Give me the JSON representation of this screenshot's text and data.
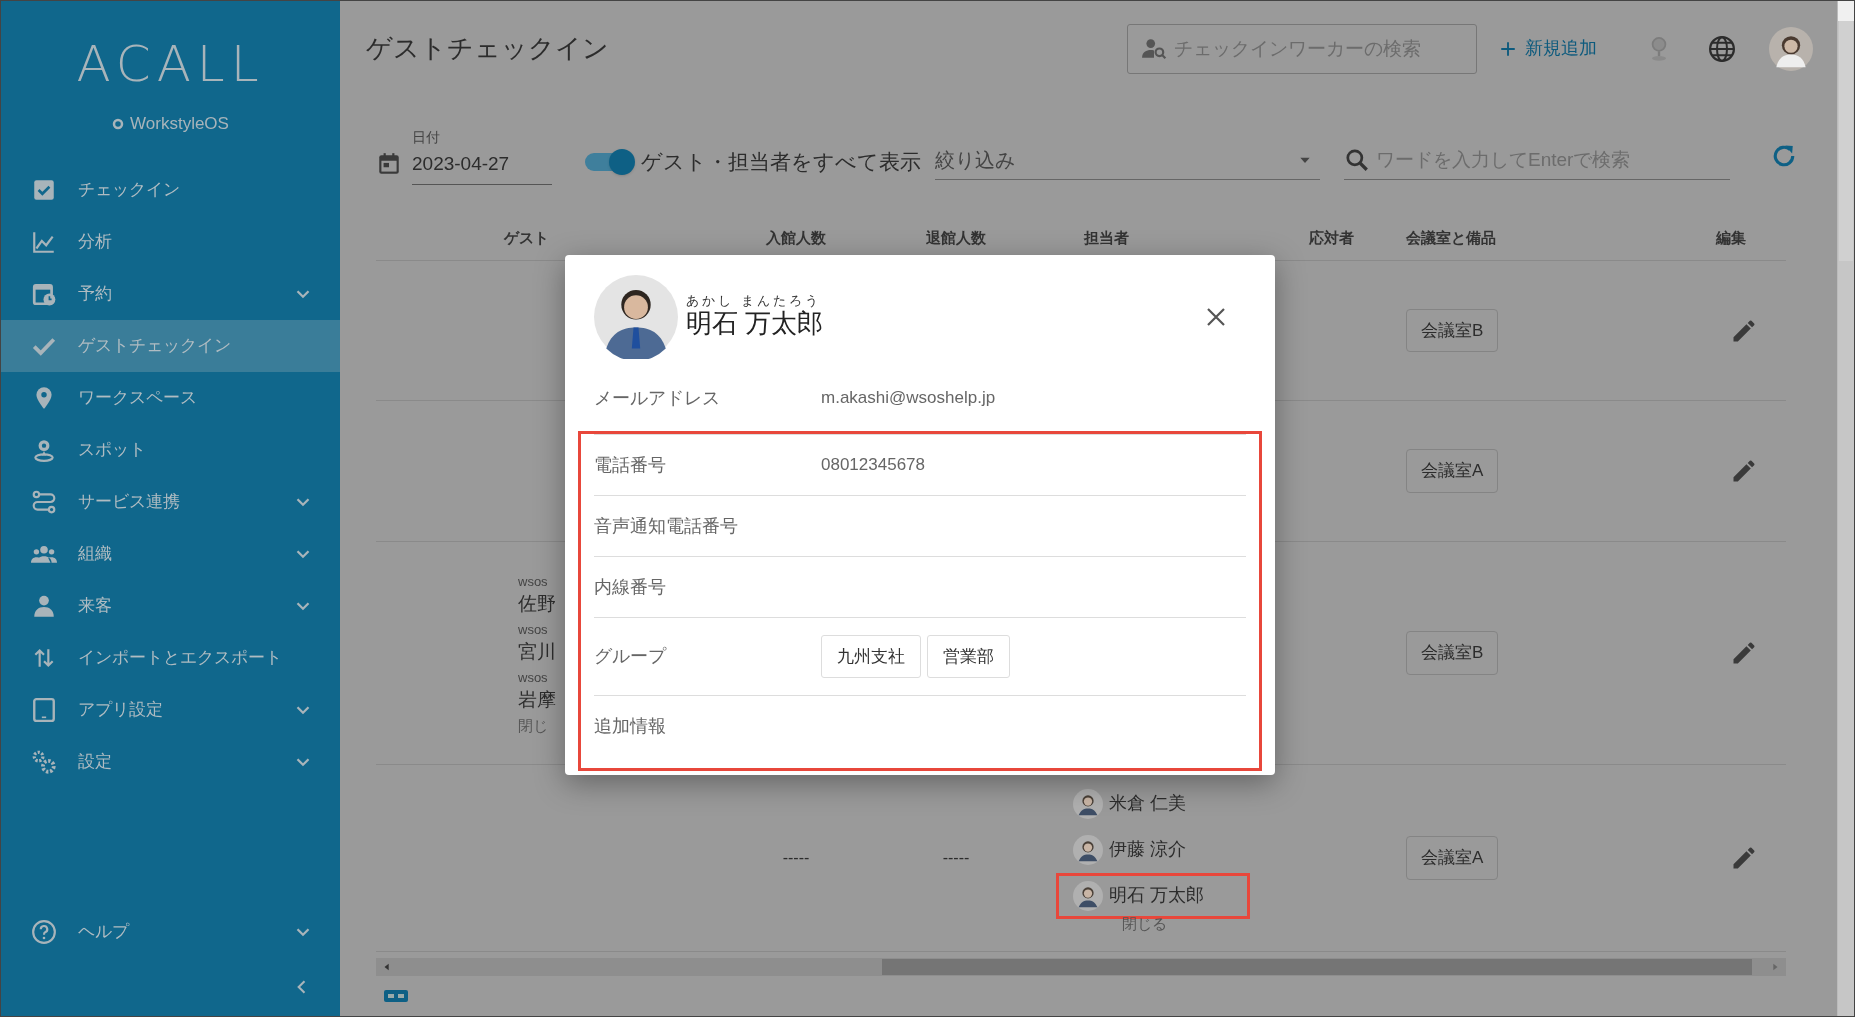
{
  "sidebar": {
    "logo": "ACALL",
    "product": "WorkstyleOS",
    "items": [
      {
        "label": "チェックイン",
        "expandable": false,
        "selected": false
      },
      {
        "label": "分析",
        "expandable": false,
        "selected": false
      },
      {
        "label": "予約",
        "expandable": true,
        "selected": false
      },
      {
        "label": "ゲストチェックイン",
        "expandable": false,
        "selected": true
      },
      {
        "label": "ワークスペース",
        "expandable": false,
        "selected": false
      },
      {
        "label": "スポット",
        "expandable": false,
        "selected": false
      },
      {
        "label": "サービス連携",
        "expandable": true,
        "selected": false
      },
      {
        "label": "組織",
        "expandable": true,
        "selected": false
      },
      {
        "label": "来客",
        "expandable": true,
        "selected": false
      },
      {
        "label": "インポートとエクスポート",
        "expandable": false,
        "selected": false
      },
      {
        "label": "アプリ設定",
        "expandable": true,
        "selected": false
      },
      {
        "label": "設定",
        "expandable": true,
        "selected": false
      }
    ],
    "help": {
      "label": "ヘルプ",
      "expandable": true
    }
  },
  "header": {
    "title": "ゲストチェックイン",
    "search": {
      "placeholder": "チェックインワーカーの検索"
    },
    "add_button": "新規追加"
  },
  "filters": {
    "date": {
      "label": "日付",
      "value": "2023-04-27"
    },
    "toggle": {
      "label": "ゲスト・担当者をすべて表示",
      "on": true
    },
    "filter": {
      "placeholder": "絞り込み"
    },
    "search": {
      "placeholder": "ワードを入力してEnterで検索"
    }
  },
  "table": {
    "columns": [
      "ゲスト",
      "入館人数",
      "退館人数",
      "担当者",
      "応対者",
      "会議室と備品",
      "編集"
    ],
    "rows": [
      {
        "room": "会議室B"
      },
      {
        "room": "会議室A"
      },
      {
        "guests": [
          {
            "company": "wsos",
            "name": "佐野"
          },
          {
            "company": "wsos",
            "name": "宮川"
          },
          {
            "company": "wsos",
            "name": "岩摩"
          }
        ],
        "guests_close": "閉じ",
        "room": "会議室B"
      },
      {
        "check_in": "-----",
        "check_out": "-----",
        "staff": [
          {
            "name": "米倉 仁美",
            "highlighted": false
          },
          {
            "name": "伊藤 涼介",
            "highlighted": false
          },
          {
            "name": "明石 万太郎",
            "highlighted": true
          }
        ],
        "staff_close": "閉じる",
        "room": "会議室A"
      }
    ]
  },
  "modal": {
    "furigana": "あかし まんたろう",
    "name": "明石 万太郎",
    "email": {
      "label": "メールアドレス",
      "value": "m.akashi@wsoshelp.jp"
    },
    "details": {
      "highlighted": true,
      "fields": [
        {
          "kind": "text",
          "label": "電話番号",
          "value": "08012345678"
        },
        {
          "kind": "text",
          "label": "音声通知電話番号"
        },
        {
          "kind": "text",
          "label": "内線番号"
        },
        {
          "kind": "tags",
          "label": "グループ",
          "tags": [
            "九州支社",
            "営業部"
          ]
        },
        {
          "kind": "text",
          "label": "追加情報"
        }
      ]
    }
  }
}
